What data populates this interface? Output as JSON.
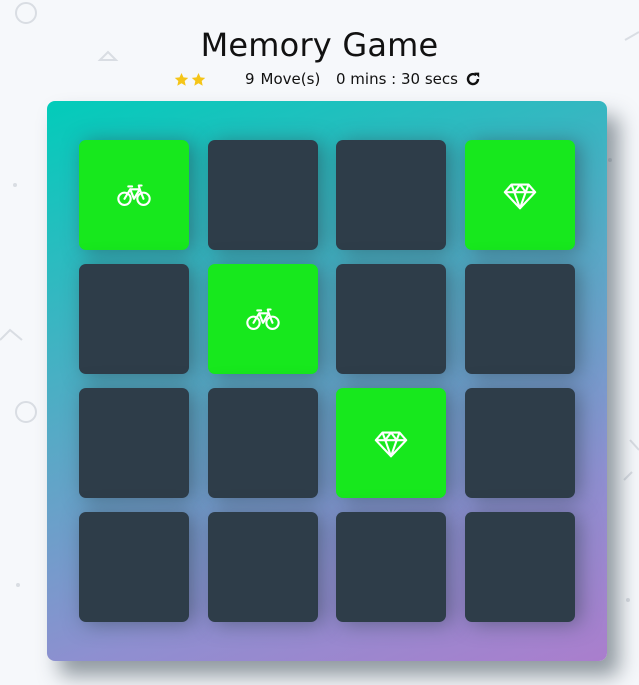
{
  "title": "Memory Game",
  "score_panel": {
    "stars_shown": 2,
    "moves_count": "9",
    "moves_label": "Move(s)",
    "timer_text": "0 mins : 30 secs"
  },
  "colors": {
    "star": "#f5c518",
    "card_hidden": "#2e3d49",
    "card_match": "#17e81d"
  },
  "deck": {
    "cards": [
      {
        "state": "match",
        "icon": "bicycle-icon"
      },
      {
        "state": "hidden",
        "icon": ""
      },
      {
        "state": "hidden",
        "icon": ""
      },
      {
        "state": "match",
        "icon": "diamond-icon"
      },
      {
        "state": "hidden",
        "icon": ""
      },
      {
        "state": "match",
        "icon": "bicycle-icon"
      },
      {
        "state": "hidden",
        "icon": ""
      },
      {
        "state": "hidden",
        "icon": ""
      },
      {
        "state": "hidden",
        "icon": ""
      },
      {
        "state": "hidden",
        "icon": ""
      },
      {
        "state": "match",
        "icon": "diamond-icon"
      },
      {
        "state": "hidden",
        "icon": ""
      },
      {
        "state": "hidden",
        "icon": ""
      },
      {
        "state": "hidden",
        "icon": ""
      },
      {
        "state": "hidden",
        "icon": ""
      },
      {
        "state": "hidden",
        "icon": ""
      }
    ]
  }
}
